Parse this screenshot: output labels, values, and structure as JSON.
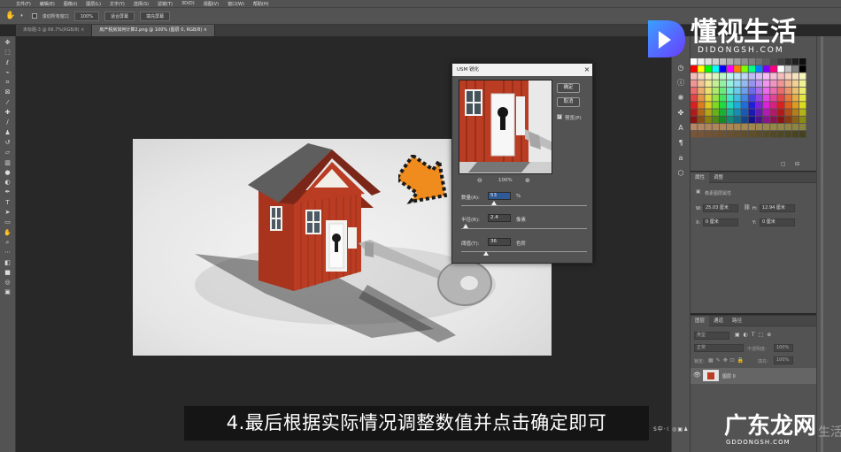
{
  "menubar": {
    "items": [
      "文件(F)",
      "编辑(E)",
      "图像(I)",
      "图层(L)",
      "文字(Y)",
      "选择(S)",
      "滤镜(T)",
      "3D(D)",
      "视图(V)",
      "窗口(W)",
      "帮助(H)"
    ]
  },
  "optionsbar": {
    "checkbox_label": "滚动所有窗口",
    "zoom_value": "100%",
    "fit_button": "适合屏幕",
    "fill_button": "填充屏幕"
  },
  "tabs": [
    {
      "label": "未标题-3 @ 66.7%(RGB/8) ×"
    },
    {
      "label": "房产税房如何计算2.png @ 100% (图层 0, RGB/8) ×"
    }
  ],
  "dialog": {
    "title": "USM 锐化",
    "ok": "确定",
    "cancel": "取消",
    "preview_label": "预览(P)",
    "preview_checked": true,
    "zoom": "100%",
    "amount_label": "数量(A):",
    "amount_value": "53",
    "amount_unit": "%",
    "radius_label": "半径(R):",
    "radius_value": "2.4",
    "radius_unit": "像素",
    "threshold_label": "阈值(T):",
    "threshold_value": "36",
    "threshold_unit": "色阶"
  },
  "properties": {
    "tab_props": "属性",
    "tab_adjust": "调整",
    "type_label": "像素图层属性",
    "w_label": "W:",
    "w_value": "25.03 厘米",
    "h_label": "H:",
    "h_value": "12.94 厘米",
    "x_label": "X:",
    "x_value": "0 厘米",
    "y_label": "Y:",
    "y_value": "0 厘米"
  },
  "layers": {
    "tab_layers": "图层",
    "tab_channels": "通道",
    "tab_paths": "路径",
    "filter_placeholder": "类型",
    "blend_mode": "正常",
    "opacity_label": "不透明度:",
    "opacity_value": "100%",
    "lock_label": "锁定:",
    "fill_label": "填充:",
    "fill_value": "100%",
    "layer_name": "图层 0"
  },
  "caption": {
    "text": "4.最后根据实际情况调整数值并点击确定即可"
  },
  "watermark_top": {
    "text": "懂视生活",
    "sub": "DIDONGSH.COM"
  },
  "watermark_bottom": {
    "text": "广东龙网",
    "sub": "GDDONGSH.COM",
    "side_text": "生活"
  },
  "colors": {
    "ui_dark": "#535353",
    "canvas": "#282828",
    "house_red": "#b43a22",
    "arrow_orange": "#f08c1e"
  }
}
